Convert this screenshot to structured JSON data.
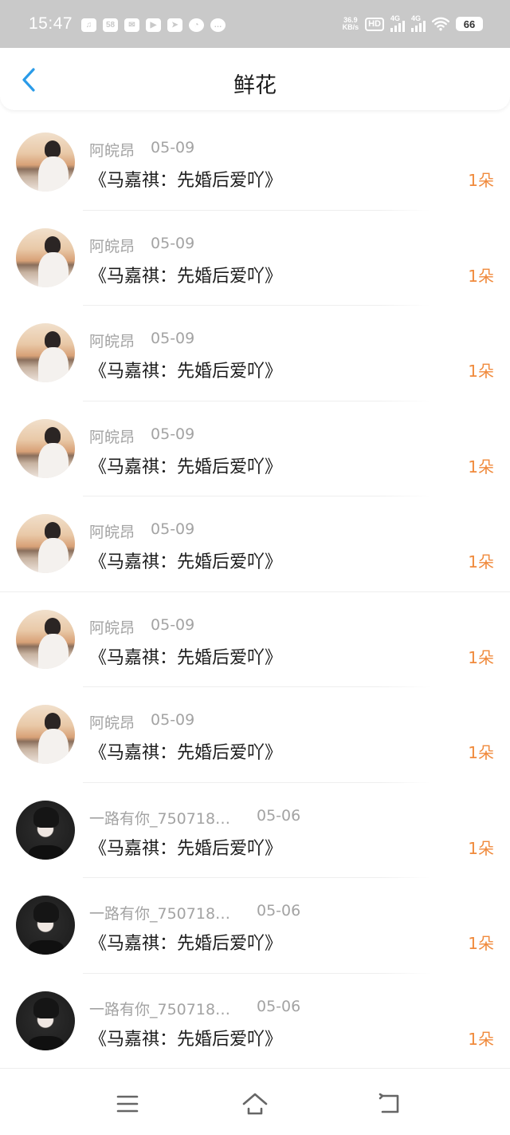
{
  "status_bar": {
    "time": "15:47",
    "left_icons": [
      "music-icon",
      "58-app-icon",
      "mail-icon",
      "play-icon",
      "telegram-icon",
      "chat-bubble-icon",
      "message-icon"
    ],
    "badge_58": "58",
    "speed_value": "36.9",
    "speed_unit": "KB/s",
    "hd_label": "HD",
    "network1": "4G",
    "network2": "4G",
    "battery": "66"
  },
  "header": {
    "title": "鲜花"
  },
  "list": [
    {
      "user": "阿皖昂",
      "date": "05-09",
      "book": "《马嘉祺：先婚后爱吖》",
      "count": "1朵",
      "avatar": "sunset"
    },
    {
      "user": "阿皖昂",
      "date": "05-09",
      "book": "《马嘉祺：先婚后爱吖》",
      "count": "1朵",
      "avatar": "sunset"
    },
    {
      "user": "阿皖昂",
      "date": "05-09",
      "book": "《马嘉祺：先婚后爱吖》",
      "count": "1朵",
      "avatar": "sunset"
    },
    {
      "user": "阿皖昂",
      "date": "05-09",
      "book": "《马嘉祺：先婚后爱吖》",
      "count": "1朵",
      "avatar": "sunset"
    },
    {
      "user": "阿皖昂",
      "date": "05-09",
      "book": "《马嘉祺：先婚后爱吖》",
      "count": "1朵",
      "avatar": "sunset"
    },
    {
      "user": "阿皖昂",
      "date": "05-09",
      "book": "《马嘉祺：先婚后爱吖》",
      "count": "1朵",
      "avatar": "sunset"
    },
    {
      "user": "阿皖昂",
      "date": "05-09",
      "book": "《马嘉祺：先婚后爱吖》",
      "count": "1朵",
      "avatar": "sunset"
    },
    {
      "user": "一路有你_750718…",
      "date": "05-06",
      "book": "《马嘉祺：先婚后爱吖》",
      "count": "1朵",
      "avatar": "dark"
    },
    {
      "user": "一路有你_750718…",
      "date": "05-06",
      "book": "《马嘉祺：先婚后爱吖》",
      "count": "1朵",
      "avatar": "dark"
    },
    {
      "user": "一路有你_750718…",
      "date": "05-06",
      "book": "《马嘉祺：先婚后爱吖》",
      "count": "1朵",
      "avatar": "dark"
    }
  ],
  "colors": {
    "status_bar_bg": "#c9c9c9",
    "accent_blue": "#2a9be8",
    "count_orange": "#f08a3c",
    "meta_gray": "#a3a3a3"
  },
  "nav_bar": {
    "buttons": [
      "menu-icon",
      "home-icon",
      "back-icon"
    ]
  }
}
